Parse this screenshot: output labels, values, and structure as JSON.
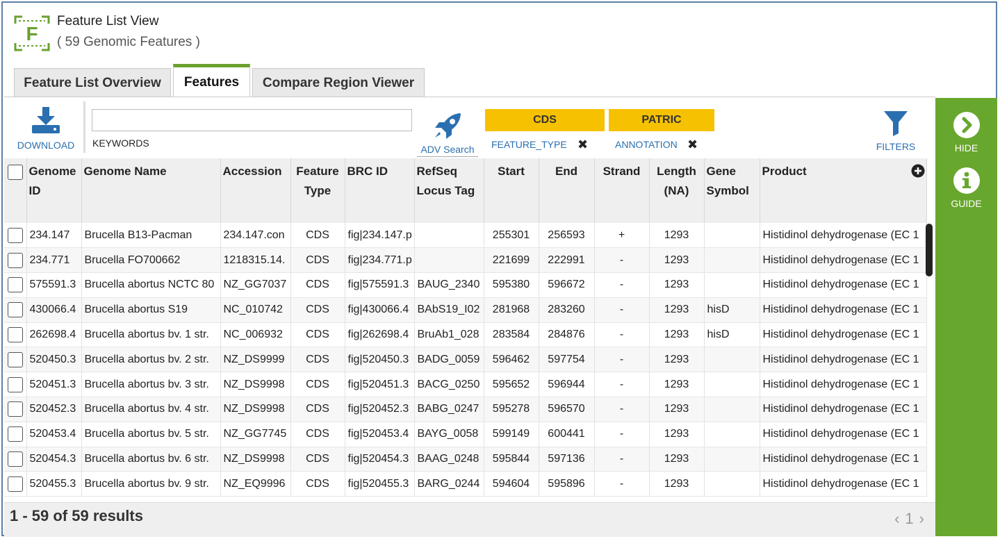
{
  "header": {
    "title": "Feature List View",
    "subtitle": "( 59 Genomic Features )",
    "logo_letter": "F"
  },
  "tabs": [
    {
      "label": "Feature List Overview",
      "active": false
    },
    {
      "label": "Features",
      "active": true
    },
    {
      "label": "Compare Region Viewer",
      "active": false
    }
  ],
  "toolbar": {
    "download_label": "DOWNLOAD",
    "keywords_label": "KEYWORDS",
    "keywords_value": "",
    "adv_search_label": "ADV Search",
    "filters_label": "FILTERS",
    "chips": [
      {
        "value": "CDS",
        "field": "FEATURE_TYPE"
      },
      {
        "value": "PATRIC",
        "field": "ANNOTATION"
      }
    ],
    "chip_color": "#f6c100"
  },
  "grid": {
    "columns": [
      {
        "key": "genome_id",
        "label": "Genome ID"
      },
      {
        "key": "genome_name",
        "label": "Genome Name"
      },
      {
        "key": "accession",
        "label": "Accession"
      },
      {
        "key": "feature_type",
        "label": "Feature Type"
      },
      {
        "key": "brc_id",
        "label": "BRC ID"
      },
      {
        "key": "refseq",
        "label": "RefSeq Locus Tag"
      },
      {
        "key": "start",
        "label": "Start"
      },
      {
        "key": "end",
        "label": "End"
      },
      {
        "key": "strand",
        "label": "Strand"
      },
      {
        "key": "length",
        "label": "Length (NA)"
      },
      {
        "key": "gene",
        "label": "Gene Symbol"
      },
      {
        "key": "product",
        "label": "Product"
      }
    ],
    "rows": [
      [
        "234.147",
        "Brucella B13-Pacman",
        "234.147.con",
        "CDS",
        "fig|234.147.p",
        "",
        "255301",
        "256593",
        "+",
        "1293",
        "",
        "Histidinol dehydrogenase (EC 1"
      ],
      [
        "234.771",
        "Brucella FO700662",
        "1218315.14.",
        "CDS",
        "fig|234.771.p",
        "",
        "221699",
        "222991",
        "-",
        "1293",
        "",
        "Histidinol dehydrogenase (EC 1"
      ],
      [
        "575591.3",
        "Brucella abortus NCTC 80",
        "NZ_GG7037",
        "CDS",
        "fig|575591.3",
        "BAUG_2340",
        "595380",
        "596672",
        "-",
        "1293",
        "",
        "Histidinol dehydrogenase (EC 1"
      ],
      [
        "430066.4",
        "Brucella abortus S19",
        "NC_010742",
        "CDS",
        "fig|430066.4",
        "BAbS19_I02",
        "281968",
        "283260",
        "-",
        "1293",
        "hisD",
        "Histidinol dehydrogenase (EC 1"
      ],
      [
        "262698.4",
        "Brucella abortus bv. 1 str.",
        "NC_006932",
        "CDS",
        "fig|262698.4",
        "BruAb1_028",
        "283584",
        "284876",
        "-",
        "1293",
        "hisD",
        "Histidinol dehydrogenase (EC 1"
      ],
      [
        "520450.3",
        "Brucella abortus bv. 2 str.",
        "NZ_DS9999",
        "CDS",
        "fig|520450.3",
        "BADG_0059",
        "596462",
        "597754",
        "-",
        "1293",
        "",
        "Histidinol dehydrogenase (EC 1"
      ],
      [
        "520451.3",
        "Brucella abortus bv. 3 str.",
        "NZ_DS9998",
        "CDS",
        "fig|520451.3",
        "BACG_0250",
        "595652",
        "596944",
        "-",
        "1293",
        "",
        "Histidinol dehydrogenase (EC 1"
      ],
      [
        "520452.3",
        "Brucella abortus bv. 4 str.",
        "NZ_DS9998",
        "CDS",
        "fig|520452.3",
        "BABG_0247",
        "595278",
        "596570",
        "-",
        "1293",
        "",
        "Histidinol dehydrogenase (EC 1"
      ],
      [
        "520453.4",
        "Brucella abortus bv. 5 str.",
        "NZ_GG7745",
        "CDS",
        "fig|520453.4",
        "BAYG_0058",
        "599149",
        "600441",
        "-",
        "1293",
        "",
        "Histidinol dehydrogenase (EC 1"
      ],
      [
        "520454.3",
        "Brucella abortus bv. 6 str.",
        "NZ_DS9998",
        "CDS",
        "fig|520454.3",
        "BAAG_0248",
        "595844",
        "597136",
        "-",
        "1293",
        "",
        "Histidinol dehydrogenase (EC 1"
      ],
      [
        "520455.3",
        "Brucella abortus bv. 9 str.",
        "NZ_EQ9996",
        "CDS",
        "fig|520455.3",
        "BARG_0244",
        "594604",
        "595896",
        "-",
        "1293",
        "",
        "Histidinol dehydrogenase (EC 1"
      ]
    ]
  },
  "footer": {
    "results": "1 - 59 of 59 results",
    "page_prev": "‹",
    "page_number": "1",
    "page_next": "›"
  },
  "right_panel": {
    "hide_label": "HIDE",
    "guide_label": "GUIDE",
    "color": "#68a72d"
  },
  "colors": {
    "accent_green": "#6aa02e",
    "link_blue": "#2a6fb0",
    "border": "#5b7fa8"
  }
}
